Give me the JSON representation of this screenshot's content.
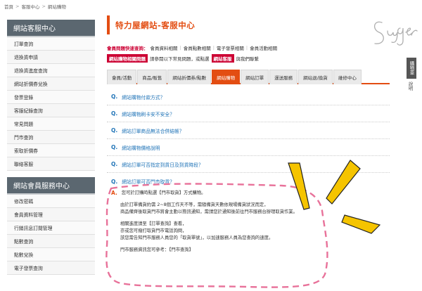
{
  "breadcrumb": [
    "首頁",
    "客服中心",
    "網站購物"
  ],
  "sidebar": {
    "service_title": "網站客服中心",
    "service_items": [
      "訂單查詢",
      "退換貨申請",
      "退換貨進度查詢",
      "網站折價券兌換",
      "發票登錄",
      "客服紀錄查詢",
      "常見問題",
      "門市查詢",
      "索取折價券",
      "聯絡客服"
    ],
    "member_title": "網站會員服務中心",
    "member_items": [
      "修改密碼",
      "會員資料管理",
      "行銷訊息訂閱管理",
      "點數查詢",
      "點數兌換",
      "電子發票查詢"
    ]
  },
  "main": {
    "title": "特力屋網站-客服中心",
    "quick": {
      "label": "會員問題快速查詢：",
      "links": [
        "會員資料相關",
        "會員點數相關",
        "電子發票相關",
        "會員活動相關"
      ]
    },
    "hint": {
      "tag": "網站購物相關問題",
      "text": "請參閱以下常見問題，或點選",
      "link": "網站客服",
      "suffix": "與我們聯繫"
    },
    "tabs": [
      "會員/活動",
      "商品/販售",
      "網站折價券/點數",
      "網站購物",
      "網站訂單",
      "運送服務",
      "網站退/換貨",
      "維修中心"
    ],
    "active_tab": "網站購物",
    "faq": [
      "網站購物付款方式？",
      "網站購物刷卡安不安全？",
      "網站訂單商品無法合併結帳？",
      "網站購物價格說明",
      "網站訂單可否指定到貨日及到貨時段？",
      "網站訂單可否門市取貨？"
    ],
    "answer": {
      "line1": "您可於訂購時點選【門市取貨】方式購物。",
      "line2": "由於訂單備貨約需 2~8個工作天不等，需隨備貨天數依現場備貨狀況而定，",
      "line3": "商品備齊後取貨門市將會主動以簡訊通知，需請您於通知後前往門市服務台辦理取貨作業。",
      "line4": "相關進度請至【訂單查詢】查看，",
      "line5": "亦或您可撥打取貨門市電話詢問，",
      "line6": "該您需告知門市服務人員您的「取貨單號」，以加速服務人員為您查詢的速度。",
      "line7": "門市服務資訊您可參考：【門市查詢】"
    }
  },
  "float": {
    "cart": "購物車",
    "help": "說明"
  },
  "signature": "Sugar",
  "colors": {
    "accent": "#e34d12",
    "link": "#1f73b7",
    "sidebar_head": "#5b6770",
    "highlight": "#f5c400",
    "dashed": "#e8729a"
  }
}
